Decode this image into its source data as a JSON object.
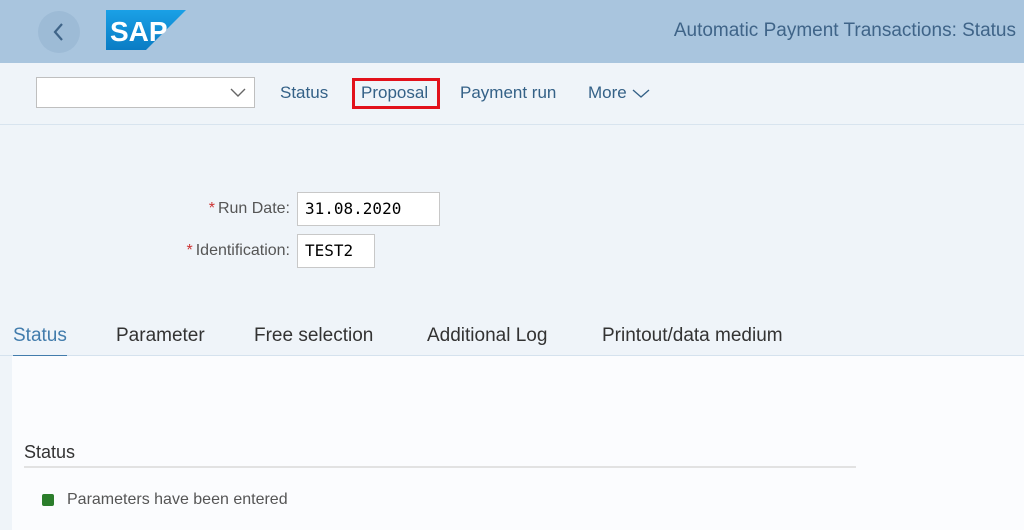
{
  "header": {
    "logo_text": "SAP",
    "title": "Automatic Payment Transactions: Status",
    "brand_color": "#0a8ad6"
  },
  "toolbar": {
    "variant_select_value": "",
    "buttons": [
      {
        "label": "Status"
      },
      {
        "label": "Proposal",
        "highlighted": true
      },
      {
        "label": "Payment run"
      },
      {
        "label": "More"
      }
    ],
    "highlight_color": "#e2111b"
  },
  "form": {
    "run_date": {
      "label": "Run Date:",
      "required_marker": "*",
      "value": "31.08.2020"
    },
    "identification": {
      "label": "Identification:",
      "required_marker": "*",
      "value": "TEST2"
    }
  },
  "tabs": [
    {
      "label": "Status",
      "active": true
    },
    {
      "label": "Parameter"
    },
    {
      "label": "Free selection"
    },
    {
      "label": "Additional Log"
    },
    {
      "label": "Printout/data medium"
    }
  ],
  "status_section": {
    "title": "Status",
    "items": [
      {
        "text": "Parameters have been entered",
        "indicator": "green",
        "indicator_color": "#2b7d2b"
      }
    ]
  }
}
